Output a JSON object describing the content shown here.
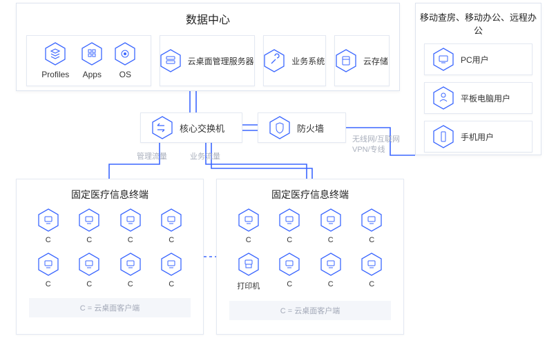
{
  "colors": {
    "accent": "#3a66ff",
    "border": "#dde3ee",
    "muted": "#a9afbc"
  },
  "datacenter": {
    "title": "数据中心",
    "group1": {
      "items": [
        {
          "icon": "layers",
          "label": "Profiles"
        },
        {
          "icon": "apps",
          "label": "Apps"
        },
        {
          "icon": "os",
          "label": "OS"
        }
      ]
    },
    "group_rest": [
      {
        "icon": "server",
        "label": "云桌面管理服务器"
      },
      {
        "icon": "wrench",
        "label": "业务系统"
      },
      {
        "icon": "storage",
        "label": "云存储"
      }
    ]
  },
  "mobile": {
    "title": "移动查房、移动办公、远程办公",
    "items": [
      {
        "icon": "pc",
        "label": "PC用户"
      },
      {
        "icon": "tablet",
        "label": "平板电脑用户"
      },
      {
        "icon": "phone",
        "label": "手机用户"
      }
    ]
  },
  "switch": {
    "icon": "switch",
    "label": "核心交换机"
  },
  "firewall": {
    "icon": "shield",
    "label": "防火墙"
  },
  "traffic_labels": {
    "management": "管理流量",
    "business": "业务流量"
  },
  "wan_label": {
    "line1": "无线网/互联网",
    "line2": "VPN/专线"
  },
  "terminals": {
    "title": "固定医疗信息终端",
    "client_short": "C",
    "legend": "C = 云桌面客户端",
    "left": {
      "cells": [
        {
          "icon": "client",
          "label": "C"
        },
        {
          "icon": "client",
          "label": "C"
        },
        {
          "icon": "client",
          "label": "C"
        },
        {
          "icon": "client",
          "label": "C"
        },
        {
          "icon": "client",
          "label": "C"
        },
        {
          "icon": "client",
          "label": "C"
        },
        {
          "icon": "client",
          "label": "C"
        },
        {
          "icon": "client",
          "label": "C"
        }
      ]
    },
    "right": {
      "cells": [
        {
          "icon": "client",
          "label": "C"
        },
        {
          "icon": "client",
          "label": "C"
        },
        {
          "icon": "client",
          "label": "C"
        },
        {
          "icon": "client",
          "label": "C"
        },
        {
          "icon": "printer",
          "label": "打印机"
        },
        {
          "icon": "client",
          "label": "C"
        },
        {
          "icon": "client",
          "label": "C"
        },
        {
          "icon": "client",
          "label": "C"
        }
      ]
    }
  }
}
